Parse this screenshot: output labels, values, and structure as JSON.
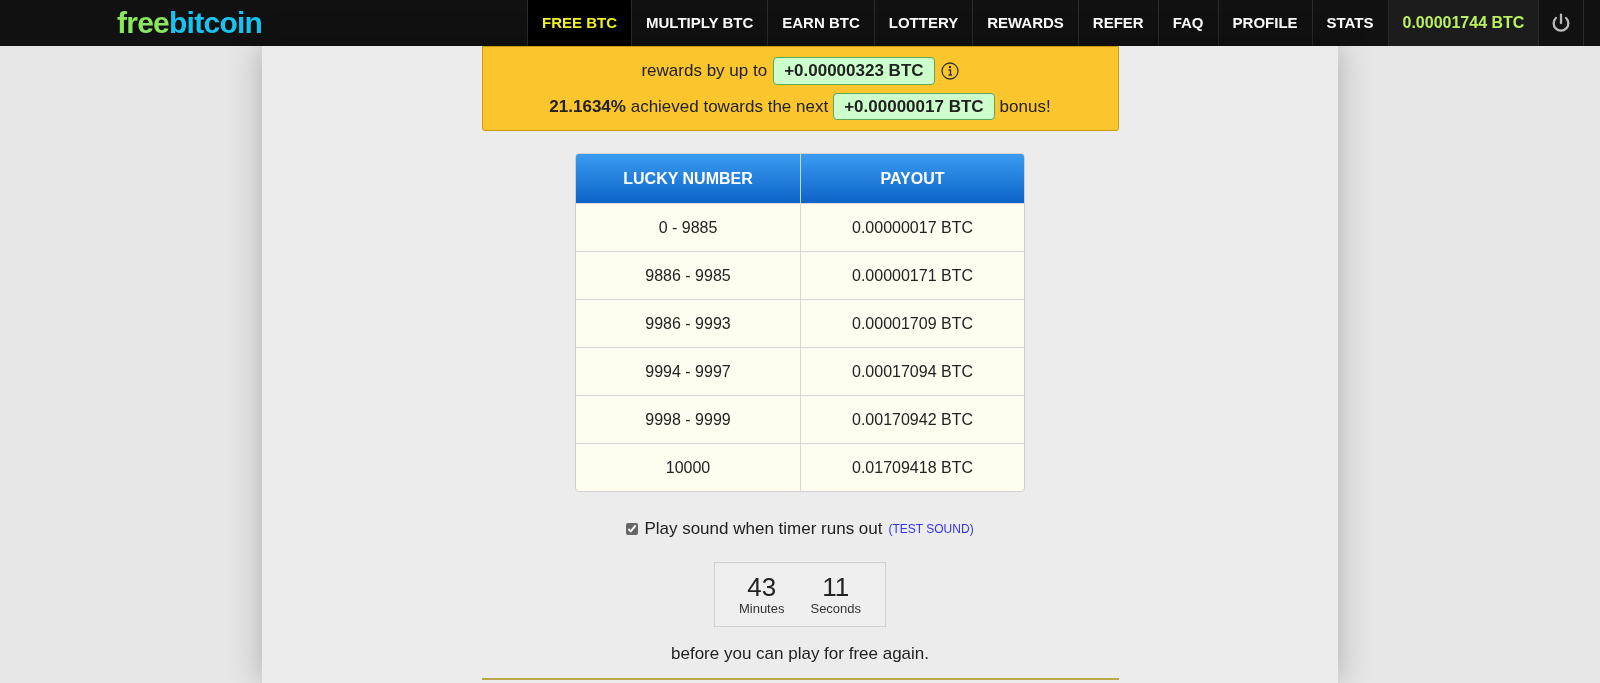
{
  "logo": {
    "first": "free",
    "second": "bitcoin"
  },
  "nav": [
    {
      "label": "FREE BTC",
      "selected": true
    },
    {
      "label": "MULTIPLY BTC",
      "selected": false
    },
    {
      "label": "EARN BTC",
      "selected": false
    },
    {
      "label": "LOTTERY",
      "selected": false
    },
    {
      "label": "REWARDS",
      "selected": false
    },
    {
      "label": "REFER",
      "selected": false
    },
    {
      "label": "FAQ",
      "selected": false
    },
    {
      "label": "PROFILE",
      "selected": false
    },
    {
      "label": "STATS",
      "selected": false
    }
  ],
  "balance": "0.00001744 BTC",
  "bonus_box": {
    "line1_text": "rewards by up to",
    "line1_amount": "+0.00000323 BTC",
    "line2_percent": "21.1634%",
    "line2_text": "achieved towards the next",
    "line2_amount": "+0.00000017 BTC",
    "line2_end": "bonus!"
  },
  "table": {
    "columns": [
      "LUCKY NUMBER",
      "PAYOUT"
    ],
    "rows": [
      [
        "0 - 9885",
        "0.00000017 BTC"
      ],
      [
        "9886 - 9985",
        "0.00000171 BTC"
      ],
      [
        "9986 - 9993",
        "0.00001709 BTC"
      ],
      [
        "9994 - 9997",
        "0.00017094 BTC"
      ],
      [
        "9998 - 9999",
        "0.00170942 BTC"
      ],
      [
        "10000",
        "0.01709418 BTC"
      ]
    ]
  },
  "sound": {
    "checked": true,
    "label": "Play sound when timer runs out",
    "link_open": "(",
    "link": "TEST SOUND",
    "link_close": ")"
  },
  "timer": [
    {
      "value": "43",
      "unit": "Minutes"
    },
    {
      "value": "11",
      "unit": "Seconds"
    }
  ],
  "footer_text": "before you can play for free again."
}
